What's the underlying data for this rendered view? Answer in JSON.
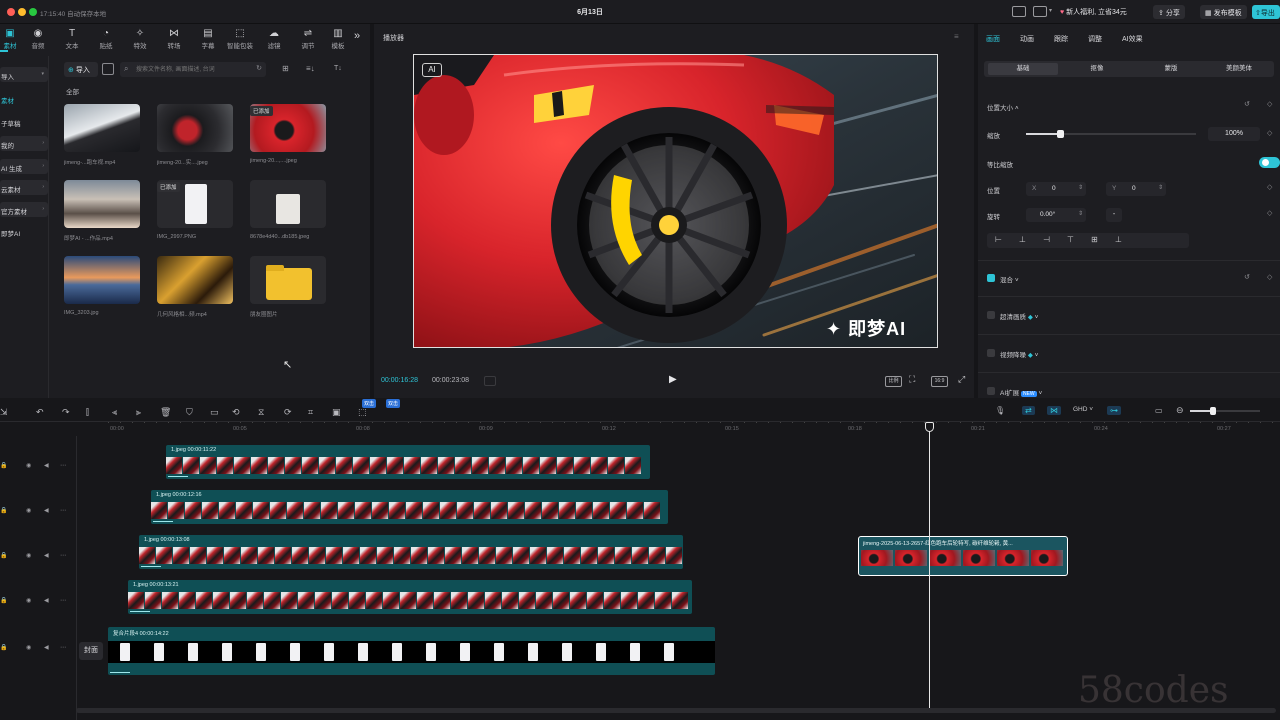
{
  "titlebar": {
    "status": "17:15:40 自动保存本地",
    "title": "6月13日",
    "promo": "新人福利, 立省34元",
    "share": "分享",
    "publish_template": "发布模板",
    "export": "导出"
  },
  "toolbar": {
    "items": [
      {
        "label": "素材",
        "icon": "media-icon"
      },
      {
        "label": "音频",
        "icon": "audio-icon"
      },
      {
        "label": "文本",
        "icon": "text-icon"
      },
      {
        "label": "贴纸",
        "icon": "sticker-icon"
      },
      {
        "label": "特效",
        "icon": "effects-icon"
      },
      {
        "label": "转场",
        "icon": "transition-icon"
      },
      {
        "label": "字幕",
        "icon": "subtitle-icon"
      },
      {
        "label": "智能包装",
        "icon": "smart-pack-icon"
      },
      {
        "label": "滤镜",
        "icon": "filter-icon"
      },
      {
        "label": "调节",
        "icon": "adjust-icon"
      },
      {
        "label": "模板",
        "icon": "template-icon"
      }
    ],
    "more": "»"
  },
  "sidebar": {
    "items": [
      {
        "label": "导入",
        "caret": "▾"
      },
      {
        "label": "素材",
        "caret": ""
      },
      {
        "label": "子草稿",
        "caret": ""
      },
      {
        "label": "我的",
        "caret": "›"
      },
      {
        "label": "AI 生成",
        "caret": "›"
      },
      {
        "label": "云素材",
        "caret": "›"
      },
      {
        "label": "官方素材",
        "caret": "›"
      },
      {
        "label": "即梦AI",
        "caret": ""
      }
    ]
  },
  "media": {
    "import_label": "导入",
    "search_placeholder": "搜索文件名称, 画面描述, 台词",
    "filter_all": "全部",
    "sort_label": "T↓",
    "items": [
      {
        "name": "jimeng-...跑车视.mp4",
        "added": ""
      },
      {
        "name": "jimeng-20...实....jpeg",
        "added": ""
      },
      {
        "name": "jimeng-20...,....jpeg",
        "added": "已添加"
      },
      {
        "name": "即梦AI - ...作品.mp4",
        "added": ""
      },
      {
        "name": "IMG_2997.PNG",
        "added": "已添加"
      },
      {
        "name": "8678e4d40...db185.jpeg",
        "added": ""
      },
      {
        "name": "IMG_3203.jpg",
        "added": ""
      },
      {
        "name": "几何风格相...频.mp4",
        "added": ""
      },
      {
        "name": "朋友圈图片",
        "added": ""
      }
    ]
  },
  "player": {
    "title": "播放器",
    "ai_badge": "AI",
    "watermark": "即梦AI",
    "current_time": "00:00:16:28",
    "total_time": "00:00:23:08",
    "ratio": "比例",
    "ratio_value": "16:9"
  },
  "inspector": {
    "tabs": [
      "画面",
      "动画",
      "跟踪",
      "调整",
      "AI效果"
    ],
    "subtabs": [
      "基础",
      "抠像",
      "蒙版",
      "美颜美体"
    ],
    "position_size": "位置大小",
    "scale_label": "缩放",
    "scale_value": "100%",
    "scale_fraction": 0.2,
    "uniform_scale": "等比缩放",
    "position_label": "位置",
    "x_label": "X",
    "x_value": "0",
    "y_label": "Y",
    "y_value": "0",
    "rotation_label": "旋转",
    "rotation_value": "0.00°",
    "rotation_extra": "-",
    "blend": "混合",
    "super_res": "超清画质",
    "video_denoise": "视频降噪",
    "ai_expand": "AI扩展",
    "new_badge": "NEW"
  },
  "timeline": {
    "ruler": [
      "00:00",
      "00:05",
      "00:08",
      "00:09",
      "00:12",
      "00:15",
      "00:18",
      "00:21",
      "00:24",
      "00:27"
    ],
    "quality": "GHD",
    "markers": [
      "双击",
      "双击"
    ],
    "cover": "封面",
    "clips": [
      {
        "name": "1.jpeg",
        "duration": "00:00:11:22"
      },
      {
        "name": "1.jpeg",
        "duration": "00:00:12:16"
      },
      {
        "name": "1.jpeg",
        "duration": "00:00:13:08"
      },
      {
        "name": "1.jpeg",
        "duration": "00:00:13:21"
      },
      {
        "name": "复合片段4",
        "duration": "00:00:14:22"
      }
    ],
    "selected_clip": "jimeng-2025-06-13-2657-红色跑车后轮特写, 碳纤维轮毂, 黄..."
  },
  "watermark_site": "58codes",
  "colors": {
    "accent": "#2ec4d6",
    "clip": "#0f4f55",
    "car_red": "#d8242b"
  }
}
